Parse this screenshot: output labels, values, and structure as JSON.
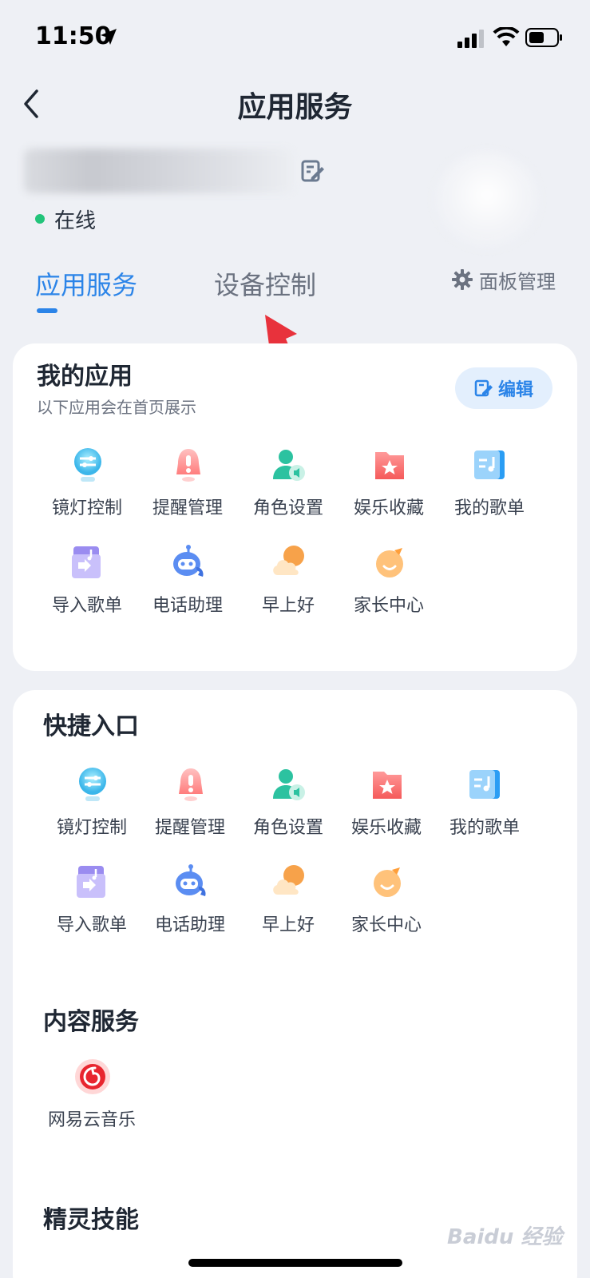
{
  "status_bar": {
    "time": "11:50"
  },
  "header": {
    "title": "应用服务"
  },
  "device": {
    "status": "在线"
  },
  "tabs": [
    {
      "label": "应用服务",
      "active": true
    },
    {
      "label": "设备控制",
      "active": false
    }
  ],
  "panel_manage_label": "面板管理",
  "my_apps": {
    "title": "我的应用",
    "subtitle": "以下应用会在首页展示",
    "edit_label": "编辑",
    "items": [
      {
        "label": "镜灯控制",
        "icon": "mirror-light-icon"
      },
      {
        "label": "提醒管理",
        "icon": "bell-icon"
      },
      {
        "label": "角色设置",
        "icon": "user-voice-icon"
      },
      {
        "label": "娱乐收藏",
        "icon": "star-folder-icon"
      },
      {
        "label": "我的歌单",
        "icon": "playlist-icon"
      },
      {
        "label": "导入歌单",
        "icon": "import-playlist-icon"
      },
      {
        "label": "电话助理",
        "icon": "robot-phone-icon"
      },
      {
        "label": "早上好",
        "icon": "sun-cloud-icon"
      },
      {
        "label": "家长中心",
        "icon": "child-face-icon"
      }
    ]
  },
  "quick_access": {
    "title": "快捷入口",
    "items": [
      {
        "label": "镜灯控制",
        "icon": "mirror-light-icon"
      },
      {
        "label": "提醒管理",
        "icon": "bell-icon"
      },
      {
        "label": "角色设置",
        "icon": "user-voice-icon"
      },
      {
        "label": "娱乐收藏",
        "icon": "star-folder-icon"
      },
      {
        "label": "我的歌单",
        "icon": "playlist-icon"
      },
      {
        "label": "导入歌单",
        "icon": "import-playlist-icon"
      },
      {
        "label": "电话助理",
        "icon": "robot-phone-icon"
      },
      {
        "label": "早上好",
        "icon": "sun-cloud-icon"
      },
      {
        "label": "家长中心",
        "icon": "child-face-icon"
      }
    ]
  },
  "content_services": {
    "title": "内容服务",
    "items": [
      {
        "label": "网易云音乐",
        "icon": "netease-music-icon"
      }
    ]
  },
  "spirit_skills": {
    "title": "精灵技能"
  },
  "watermark": "Baidu 经验",
  "colors": {
    "accent": "#2b84e8",
    "online": "#22c47a",
    "annotation_arrow": "#e8323c"
  }
}
